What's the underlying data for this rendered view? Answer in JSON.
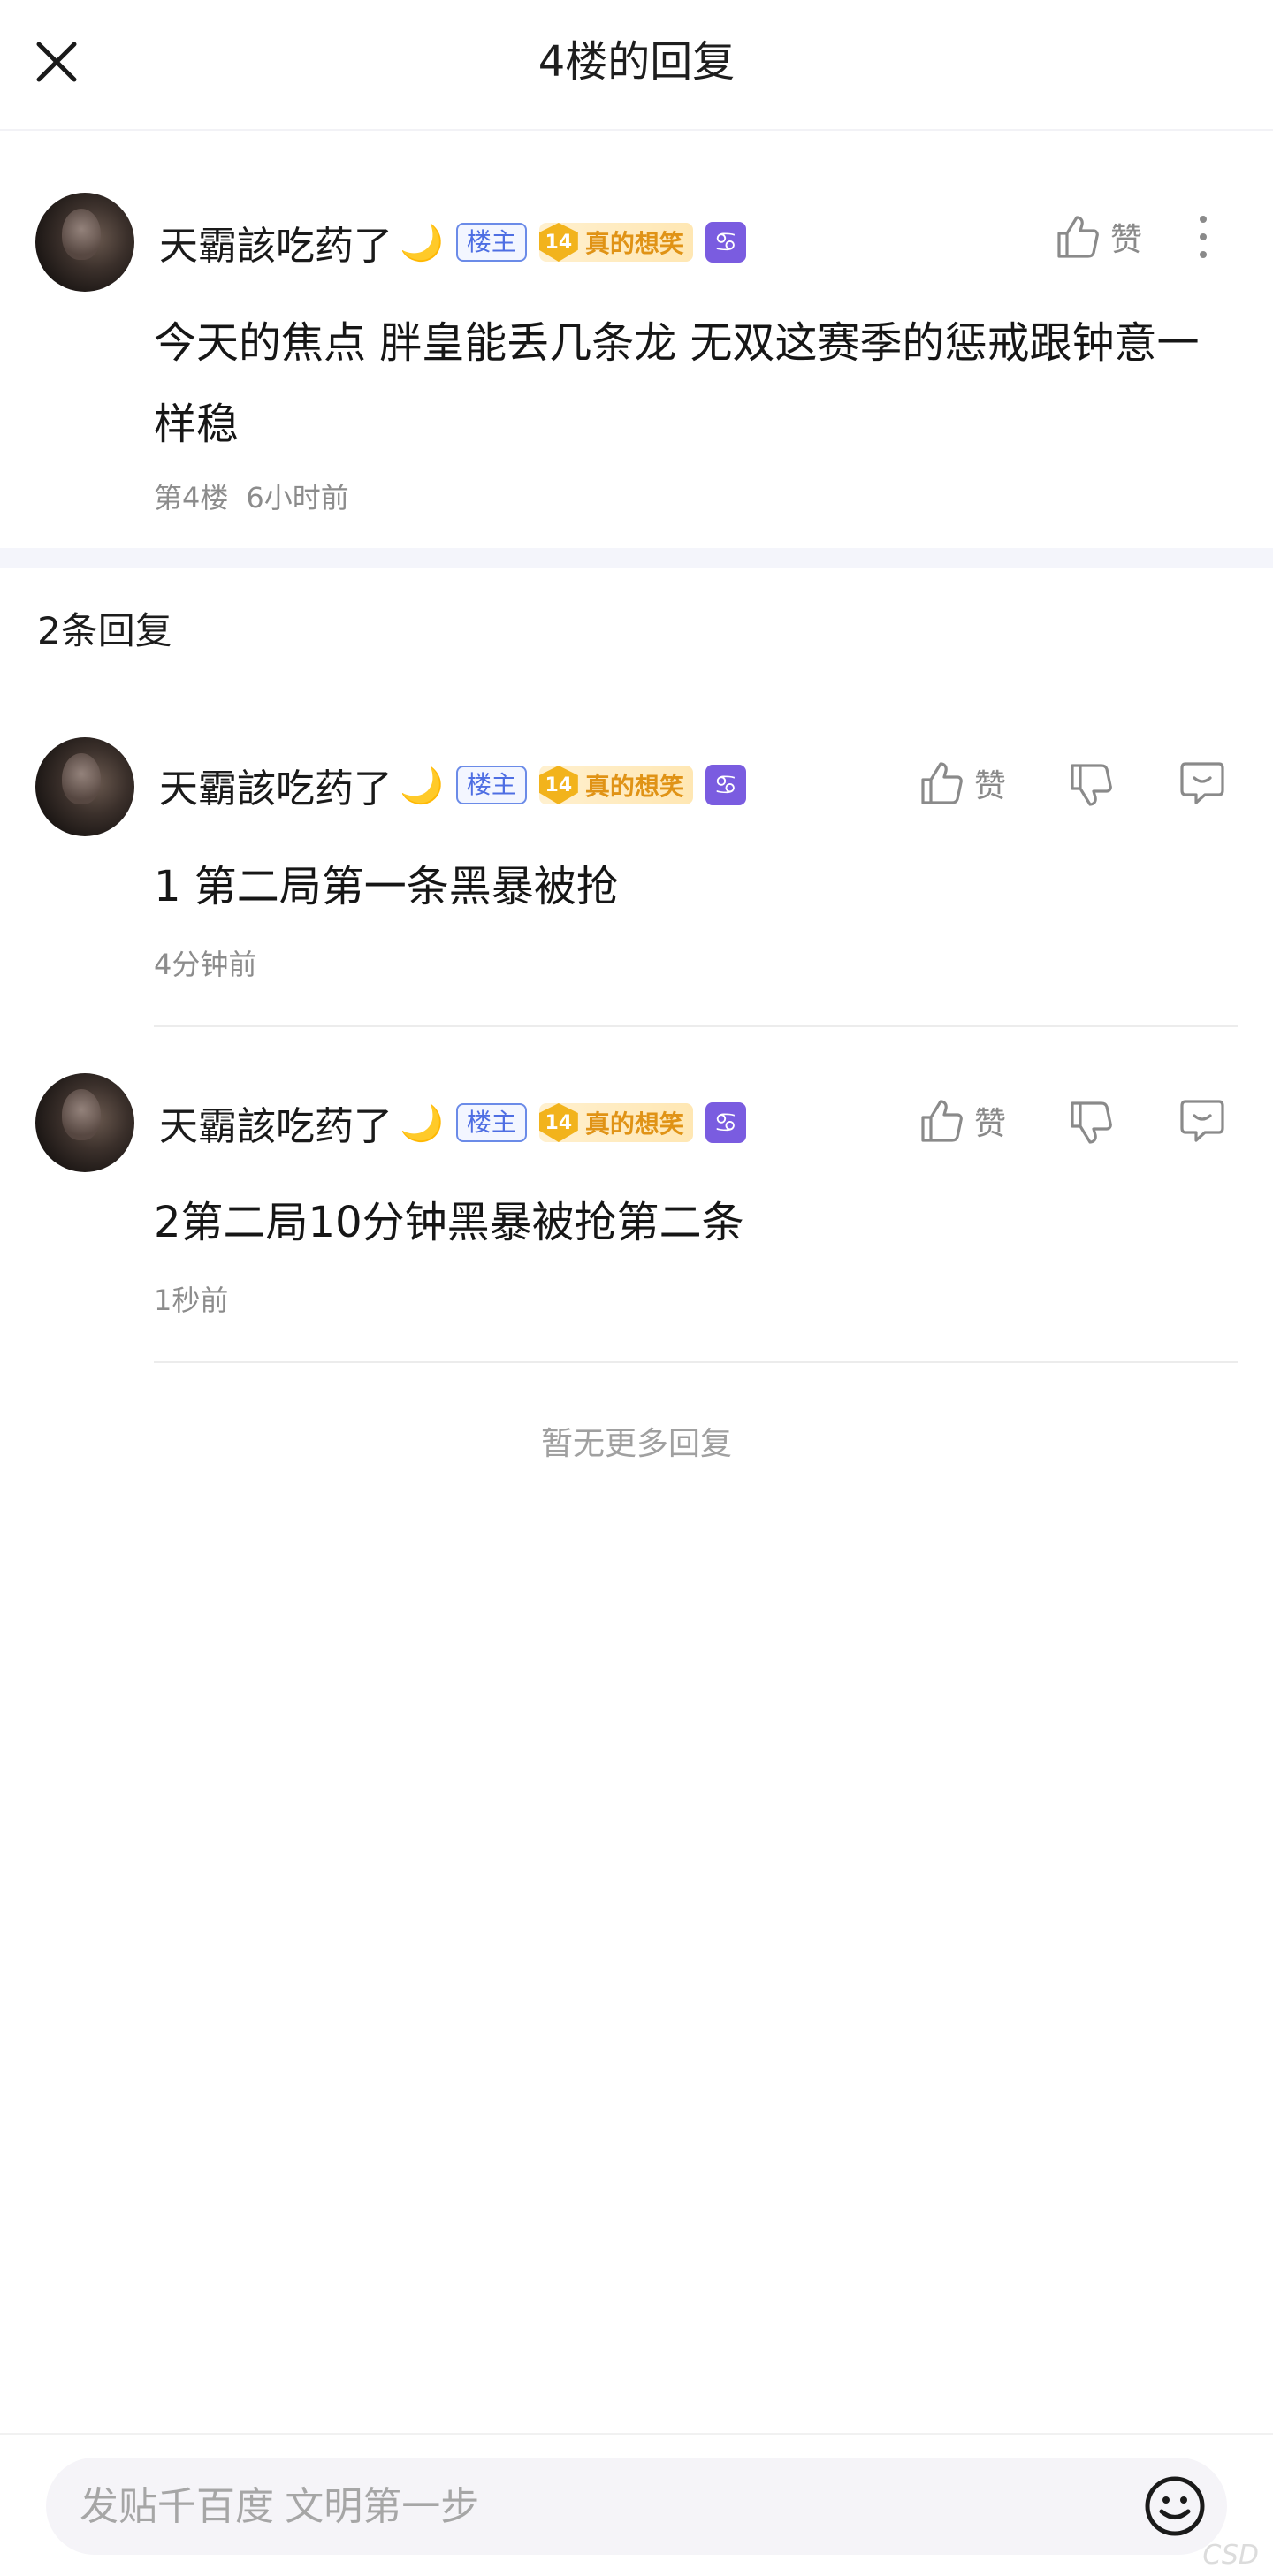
{
  "header": {
    "title": "4楼的回复"
  },
  "post": {
    "username": "天霸該吃药了",
    "moon": "🌙",
    "owner_badge": "楼主",
    "level_num": "14",
    "level_name": "真的想笑",
    "zodiac": "♋",
    "like_label": "赞",
    "text": "今天的焦点 胖皇能丢几条龙 无双这赛季的惩戒跟钟意一样稳",
    "floor": "第4楼",
    "time": "6小时前"
  },
  "reply_count": "2条回复",
  "replies": [
    {
      "username": "天霸該吃药了",
      "moon": "🌙",
      "owner_badge": "楼主",
      "level_num": "14",
      "level_name": "真的想笑",
      "zodiac": "♋",
      "like_label": "赞",
      "text": "1 第二局第一条黑暴被抢",
      "time": "4分钟前"
    },
    {
      "username": "天霸該吃药了",
      "moon": "🌙",
      "owner_badge": "楼主",
      "level_num": "14",
      "level_name": "真的想笑",
      "zodiac": "♋",
      "like_label": "赞",
      "text": "2第二局10分钟黑暴被抢第二条",
      "time": "1秒前"
    }
  ],
  "no_more": "暂无更多回复",
  "input": {
    "placeholder": "发贴千百度 文明第一步"
  },
  "watermark": "CSD"
}
